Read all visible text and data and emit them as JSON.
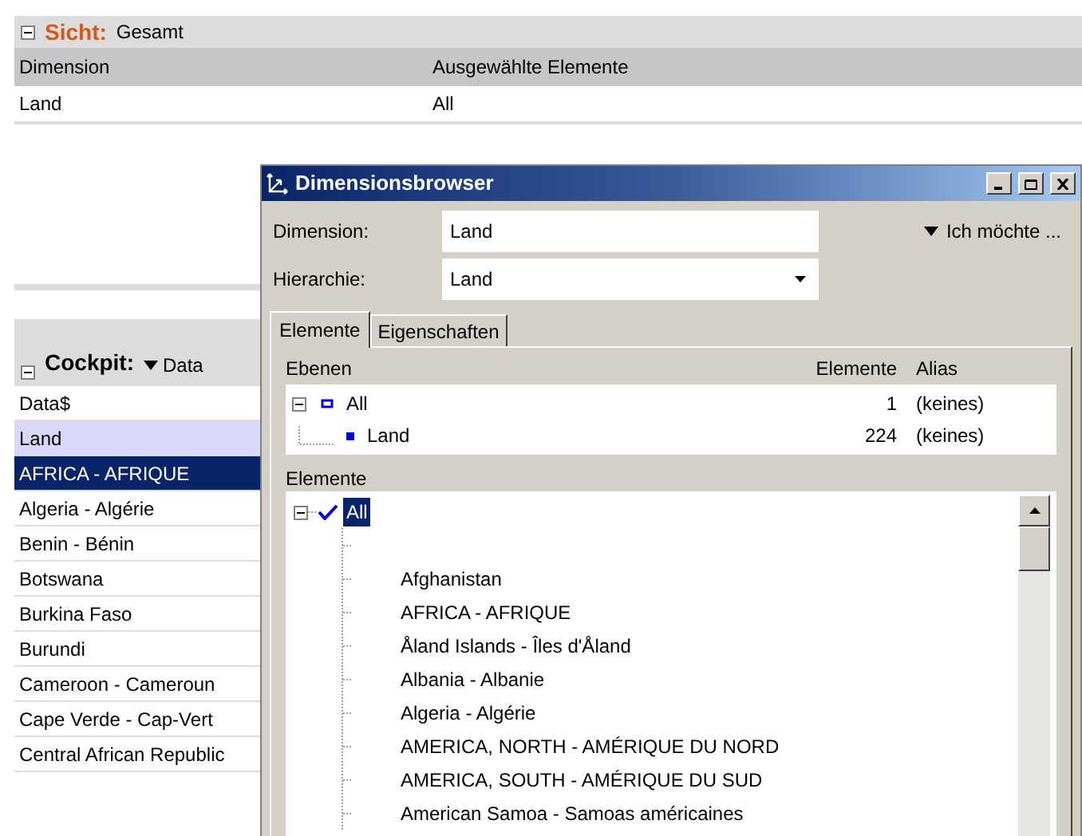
{
  "view": {
    "label": "Sicht:",
    "value": "Gesamt",
    "expanded": true,
    "columns": [
      "Dimension",
      "Ausgewählte Elemente"
    ],
    "rows": [
      [
        "Land",
        "All"
      ]
    ]
  },
  "cockpit": {
    "label": "Cockpit:",
    "dropdown": "Data",
    "expanded": true,
    "rows": [
      {
        "text": "Data$",
        "kind": "plain",
        "selected": false
      },
      {
        "text": "Land",
        "kind": "dimension",
        "selected": false
      },
      {
        "text": "AFRICA - AFRIQUE",
        "kind": "plain",
        "selected": true
      },
      {
        "text": "Algeria - Algérie",
        "kind": "plain",
        "selected": false
      },
      {
        "text": "Benin - Bénin",
        "kind": "plain",
        "selected": false
      },
      {
        "text": "Botswana",
        "kind": "plain",
        "selected": false
      },
      {
        "text": "Burkina Faso",
        "kind": "plain",
        "selected": false
      },
      {
        "text": "Burundi",
        "kind": "plain",
        "selected": false
      },
      {
        "text": "Cameroon - Cameroun",
        "kind": "plain",
        "selected": false
      },
      {
        "text": "Cape Verde - Cap-Vert",
        "kind": "plain",
        "selected": false
      },
      {
        "text": "Central African Republic",
        "kind": "plain",
        "selected": false
      }
    ]
  },
  "dialog": {
    "title": "Dimensionsbrowser",
    "fields": [
      {
        "label": "Dimension:",
        "value": "Land",
        "kind": "text"
      },
      {
        "label": "Hierarchie:",
        "value": "Land",
        "kind": "dropdown"
      }
    ],
    "menu": "Ich möchte ...",
    "tabs": [
      {
        "label": "Elemente",
        "selected": true
      },
      {
        "label": "Eigenschaften",
        "selected": false
      }
    ],
    "levels": {
      "columns": [
        "Ebenen",
        "Elemente",
        "Alias"
      ],
      "rows": [
        {
          "name": "All",
          "count": "1",
          "alias": "(keines)",
          "expanded": true,
          "children": [
            {
              "name": "Land",
              "count": "224",
              "alias": "(keines)"
            }
          ]
        }
      ]
    },
    "elements_label": "Elemente",
    "tree": {
      "root": "All",
      "checked": true,
      "selected": true,
      "expanded": true,
      "children": [
        {
          "kind": "blank"
        },
        {
          "kind": "item",
          "name": "Afghanistan"
        },
        {
          "kind": "item",
          "name": "AFRICA - AFRIQUE"
        },
        {
          "kind": "item",
          "name": "Åland Islands - Îles d'Åland"
        },
        {
          "kind": "item",
          "name": "Albania - Albanie"
        },
        {
          "kind": "item",
          "name": "Algeria - Algérie"
        },
        {
          "kind": "item",
          "name": "AMERICA, NORTH - AMÉRIQUE DU NORD"
        },
        {
          "kind": "item",
          "name": "AMERICA, SOUTH - AMÉRIQUE DU SUD"
        },
        {
          "kind": "item",
          "name": "American Samoa - Samoas américaines"
        }
      ]
    }
  }
}
